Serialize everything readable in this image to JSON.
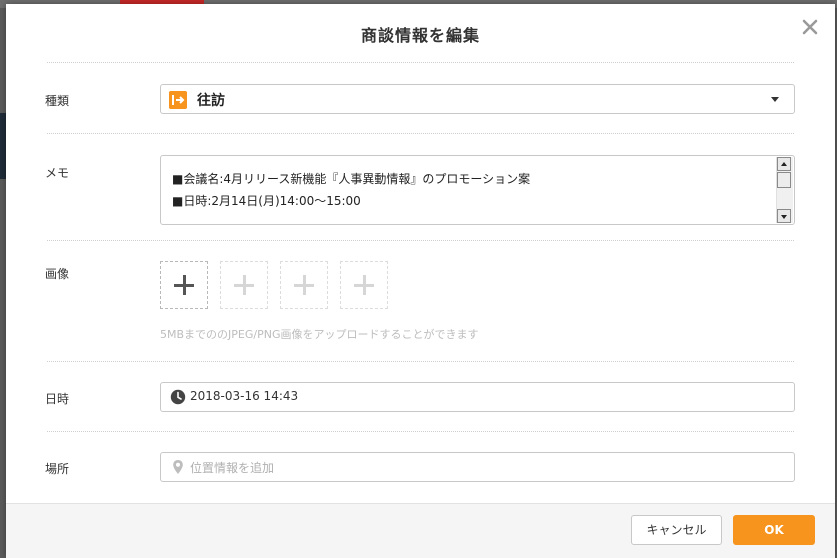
{
  "dialog": {
    "title": "商談情報を編集"
  },
  "fields": {
    "type": {
      "label": "種類",
      "value": "往訪",
      "icon": "arrow-right-box-icon",
      "accent": "#f7941d"
    },
    "memo": {
      "label": "メモ",
      "lines": [
        "■会議名:4月リリース新機能『人事異動情報』のプロモーション案",
        "■日時:2月14日(月)14:00〜15:00"
      ]
    },
    "image": {
      "label": "画像",
      "hint": "5MBまでののJPEG/PNG画像をアップロードすることができます"
    },
    "datetime": {
      "label": "日時",
      "value": "2018-03-16 14:43",
      "icon": "clock-icon"
    },
    "location": {
      "label": "場所",
      "placeholder": "位置情報を追加",
      "icon": "location-pin-icon"
    }
  },
  "footer": {
    "cancel_label": "キャンセル",
    "ok_label": "OK"
  }
}
